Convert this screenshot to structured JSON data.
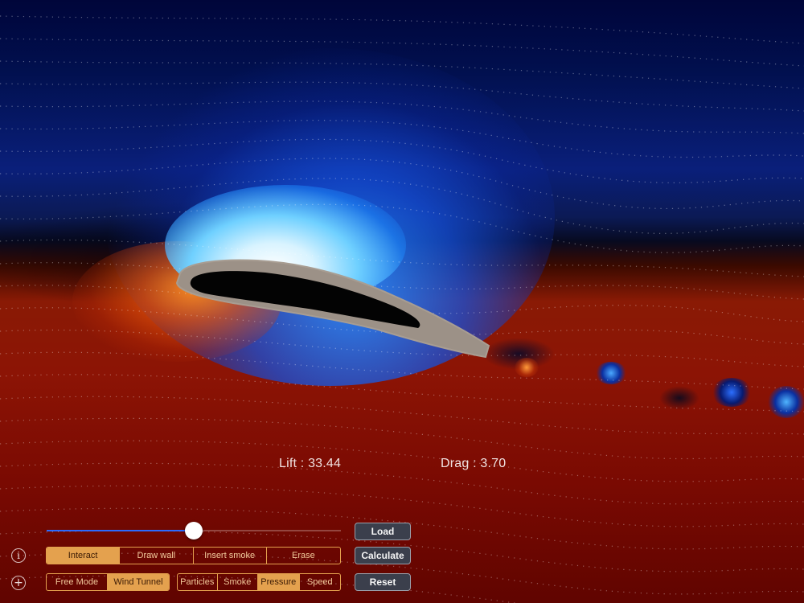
{
  "readouts": {
    "lift": "Lift : 33.44",
    "drag": "Drag : 3.70"
  },
  "slider": {
    "value": 0.5
  },
  "mode_tabs": [
    {
      "label": "Interact",
      "active": true
    },
    {
      "label": "Draw wall",
      "active": false
    },
    {
      "label": "Insert smoke",
      "active": false
    },
    {
      "label": "Erase",
      "active": false
    }
  ],
  "tunnel_tabs": [
    {
      "label": "Free Mode",
      "active": false
    },
    {
      "label": "Wind Tunnel",
      "active": true
    }
  ],
  "view_tabs": [
    {
      "label": "Particles",
      "active": false
    },
    {
      "label": "Smoke",
      "active": false
    },
    {
      "label": "Pressure",
      "active": true
    },
    {
      "label": "Speed",
      "active": false
    }
  ],
  "buttons": {
    "load": "Load",
    "calculate": "Calculate",
    "reset": "Reset"
  },
  "icons": {
    "info": "info-icon",
    "add": "plus-circle-icon"
  },
  "colors": {
    "accent": "#e4a14e",
    "slider_fill": "#2b6bff",
    "button_bg": "#3b3f4c"
  }
}
